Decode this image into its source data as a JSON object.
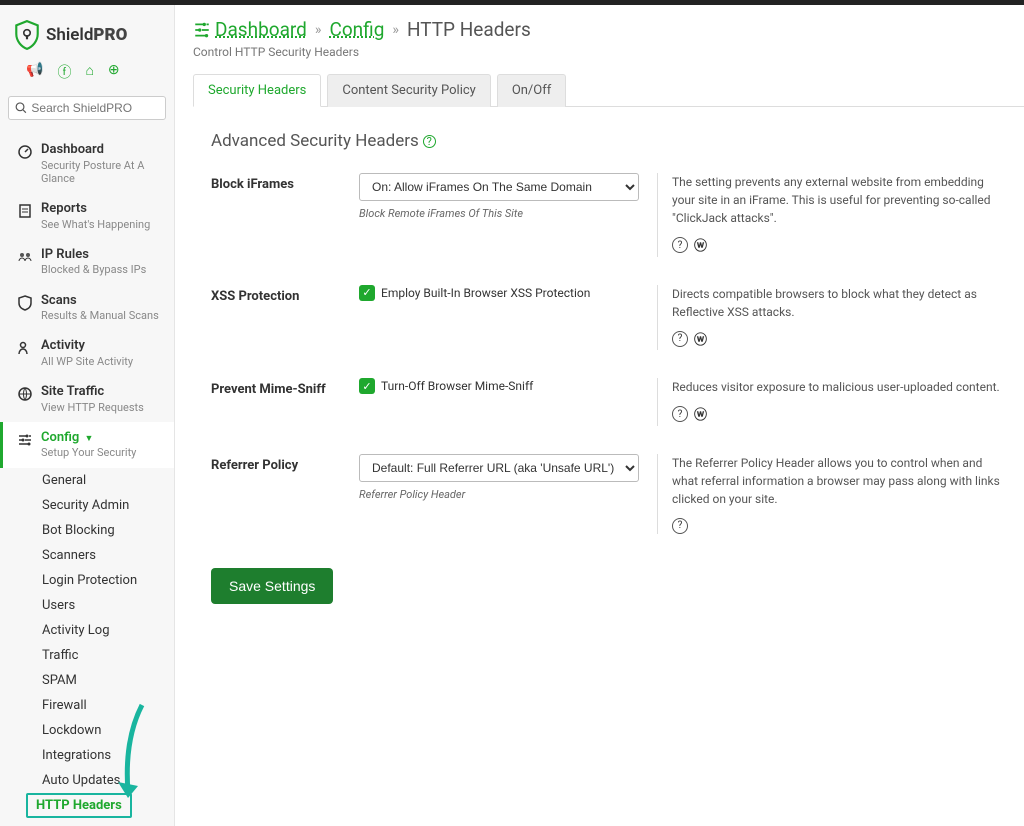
{
  "brand": {
    "name": "Shield",
    "suffix": "PRO"
  },
  "search": {
    "placeholder": "Search ShieldPRO"
  },
  "nav": [
    {
      "label": "Dashboard",
      "sub": "Security Posture At A Glance",
      "icon": "dashboard"
    },
    {
      "label": "Reports",
      "sub": "See What's Happening",
      "icon": "reports"
    },
    {
      "label": "IP Rules",
      "sub": "Blocked & Bypass IPs",
      "icon": "iprules"
    },
    {
      "label": "Scans",
      "sub": "Results & Manual Scans",
      "icon": "scans"
    },
    {
      "label": "Activity",
      "sub": "All WP Site Activity",
      "icon": "activity"
    },
    {
      "label": "Site Traffic",
      "sub": "View HTTP Requests",
      "icon": "traffic"
    },
    {
      "label": "Config",
      "sub": "Setup Your Security",
      "icon": "config",
      "active": true,
      "caret": true
    }
  ],
  "subnav": [
    "General",
    "Security Admin",
    "Bot Blocking",
    "Scanners",
    "Login Protection",
    "Users",
    "Activity Log",
    "Traffic",
    "SPAM",
    "Firewall",
    "Lockdown",
    "Integrations",
    "Auto Updates",
    "HTTP Headers"
  ],
  "subnav_active": "HTTP Headers",
  "breadcrumb": {
    "root": "Dashboard",
    "mid": "Config",
    "current": "HTTP Headers"
  },
  "page_subtitle": "Control HTTP Security Headers",
  "tabs": [
    {
      "label": "Security Headers",
      "active": true
    },
    {
      "label": "Content Security Policy"
    },
    {
      "label": "On/Off"
    }
  ],
  "section_title": "Advanced Security Headers",
  "settings": {
    "block_iframes": {
      "label": "Block iFrames",
      "select_value": "On: Allow iFrames On The Same Domain",
      "hint": "Block Remote iFrames Of This Site",
      "desc": "The setting prevents any external website from embedding your site in an iFrame. This is useful for preventing so-called \"ClickJack attacks\"."
    },
    "xss": {
      "label": "XSS Protection",
      "checkbox_label": "Employ Built-In Browser XSS Protection",
      "desc": "Directs compatible browsers to block what they detect as Reflective XSS attacks."
    },
    "mime": {
      "label": "Prevent Mime-Sniff",
      "checkbox_label": "Turn-Off Browser Mime-Sniff",
      "desc": "Reduces visitor exposure to malicious user-uploaded content."
    },
    "referrer": {
      "label": "Referrer Policy",
      "select_value": "Default: Full Referrer URL (aka 'Unsafe URL')",
      "hint": "Referrer Policy Header",
      "desc": "The Referrer Policy Header allows you to control when and what referral information a browser may pass along with links clicked on your site."
    }
  },
  "save_button": "Save Settings"
}
